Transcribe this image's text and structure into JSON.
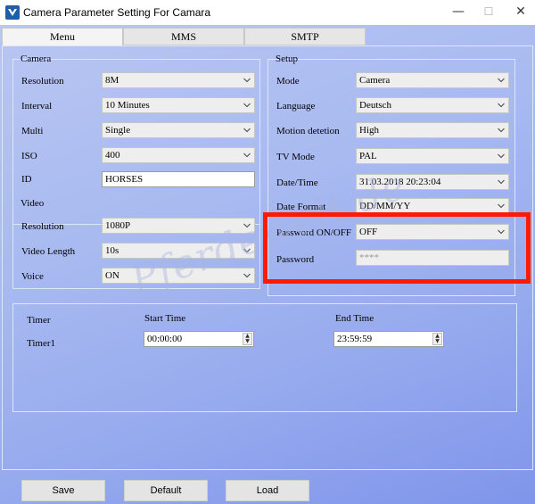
{
  "window": {
    "title": "Camera Parameter Setting For  Camara",
    "minimize": "—",
    "maximize": "☐",
    "close": "✕"
  },
  "tabs": [
    "Menu",
    "MMS",
    "SMTP"
  ],
  "camera": {
    "title": "Camera",
    "resolution_label": "Resolution",
    "resolution_value": "8M",
    "interval_label": "Interval",
    "interval_value": "10 Minutes",
    "multi_label": "Multi",
    "multi_value": "Single",
    "iso_label": "ISO",
    "iso_value": "400",
    "id_label": "ID",
    "id_value": "HORSES"
  },
  "video": {
    "title": "Video",
    "resolution_label": "Resolution",
    "resolution_value": "1080P",
    "length_label": "Video Length",
    "length_value": "10s",
    "voice_label": "Voice",
    "voice_value": "ON"
  },
  "setup": {
    "title": "Setup",
    "mode_label": "Mode",
    "mode_value": "Camera",
    "language_label": "Language",
    "language_value": "Deutsch",
    "motion_label": "Motion detetion",
    "motion_value": "High",
    "tv_label": "TV Mode",
    "tv_value": "PAL",
    "datetime_label": "Date/Time",
    "datetime_value": "31.03.2018 20:23:04",
    "dateformat_label": "Date Format",
    "dateformat_value": "DD/MM/YY",
    "password_onoff_label": "Password ON/OFF",
    "password_onoff_value": "OFF",
    "password_label": "Password",
    "password_value": "****"
  },
  "timer": {
    "title": "Timer",
    "row_label": "Timer1",
    "start_label": "Start Time",
    "start_value": "00:00:00",
    "end_label": "End Time",
    "end_value": "23:59:59"
  },
  "watermark": "Pferdewelt.de",
  "buttons": {
    "save": "Save",
    "default": "Default",
    "load": "Load"
  },
  "colors": {
    "highlight": "#ff1a00",
    "background_top": "#b9c6f2",
    "background_bottom": "#7f95ea"
  }
}
